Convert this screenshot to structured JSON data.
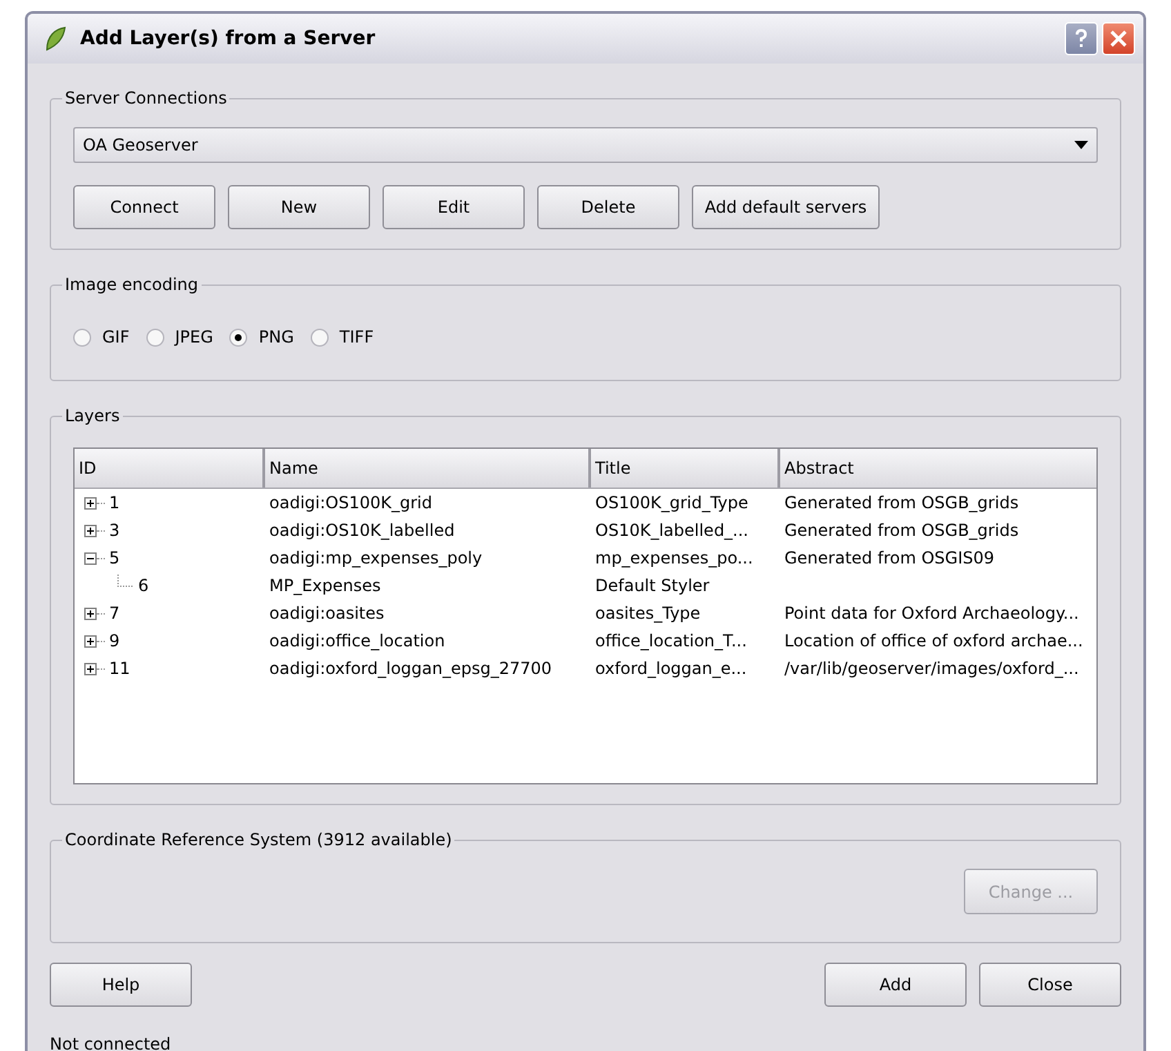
{
  "window": {
    "title": "Add Layer(s) from a Server"
  },
  "server_connections": {
    "title": "Server Connections",
    "selected_server": "OA Geoserver",
    "buttons": [
      {
        "label": "Connect"
      },
      {
        "label": "New"
      },
      {
        "label": "Edit"
      },
      {
        "label": "Delete"
      },
      {
        "label": "Add default servers"
      }
    ]
  },
  "image_encoding": {
    "title": "Image encoding",
    "options": [
      {
        "label": "GIF",
        "selected": false
      },
      {
        "label": "JPEG",
        "selected": false
      },
      {
        "label": "PNG",
        "selected": true
      },
      {
        "label": "TIFF",
        "selected": false
      }
    ]
  },
  "layers": {
    "title": "Layers",
    "columns": [
      "ID",
      "Name",
      "Title",
      "Abstract"
    ],
    "rows": [
      {
        "id": "1",
        "name": "oadigi:OS100K_grid",
        "title": "OS100K_grid_Type",
        "abstract": "Generated from OSGB_grids",
        "expanded": false
      },
      {
        "id": "3",
        "name": "oadigi:OS10K_labelled",
        "title": "OS10K_labelled_...",
        "abstract": "Generated from OSGB_grids",
        "expanded": false
      },
      {
        "id": "5",
        "name": "oadigi:mp_expenses_poly",
        "title": "mp_expenses_po...",
        "abstract": "Generated from OSGIS09",
        "expanded": true,
        "children": [
          {
            "id": "6",
            "name": "MP_Expenses",
            "title": "Default Styler"
          }
        ]
      },
      {
        "id": "7",
        "name": "oadigi:oasites",
        "title": "oasites_Type",
        "abstract": "Point data for Oxford Archaeology...",
        "expanded": false
      },
      {
        "id": "9",
        "name": "oadigi:office_location",
        "title": "office_location_T...",
        "abstract": "Location of office of oxford archae...",
        "expanded": false
      },
      {
        "id": "11",
        "name": "oadigi:oxford_loggan_epsg_27700",
        "title": "oxford_loggan_e...",
        "abstract": "/var/lib/geoserver/images/oxford_...",
        "expanded": false
      }
    ]
  },
  "crs": {
    "title": "Coordinate Reference System (3912 available)",
    "change_button": {
      "label": "Change ...",
      "disabled": true
    }
  },
  "buttons": {
    "help": "Help",
    "add": "Add",
    "close": "Close"
  },
  "status": "Not connected"
}
